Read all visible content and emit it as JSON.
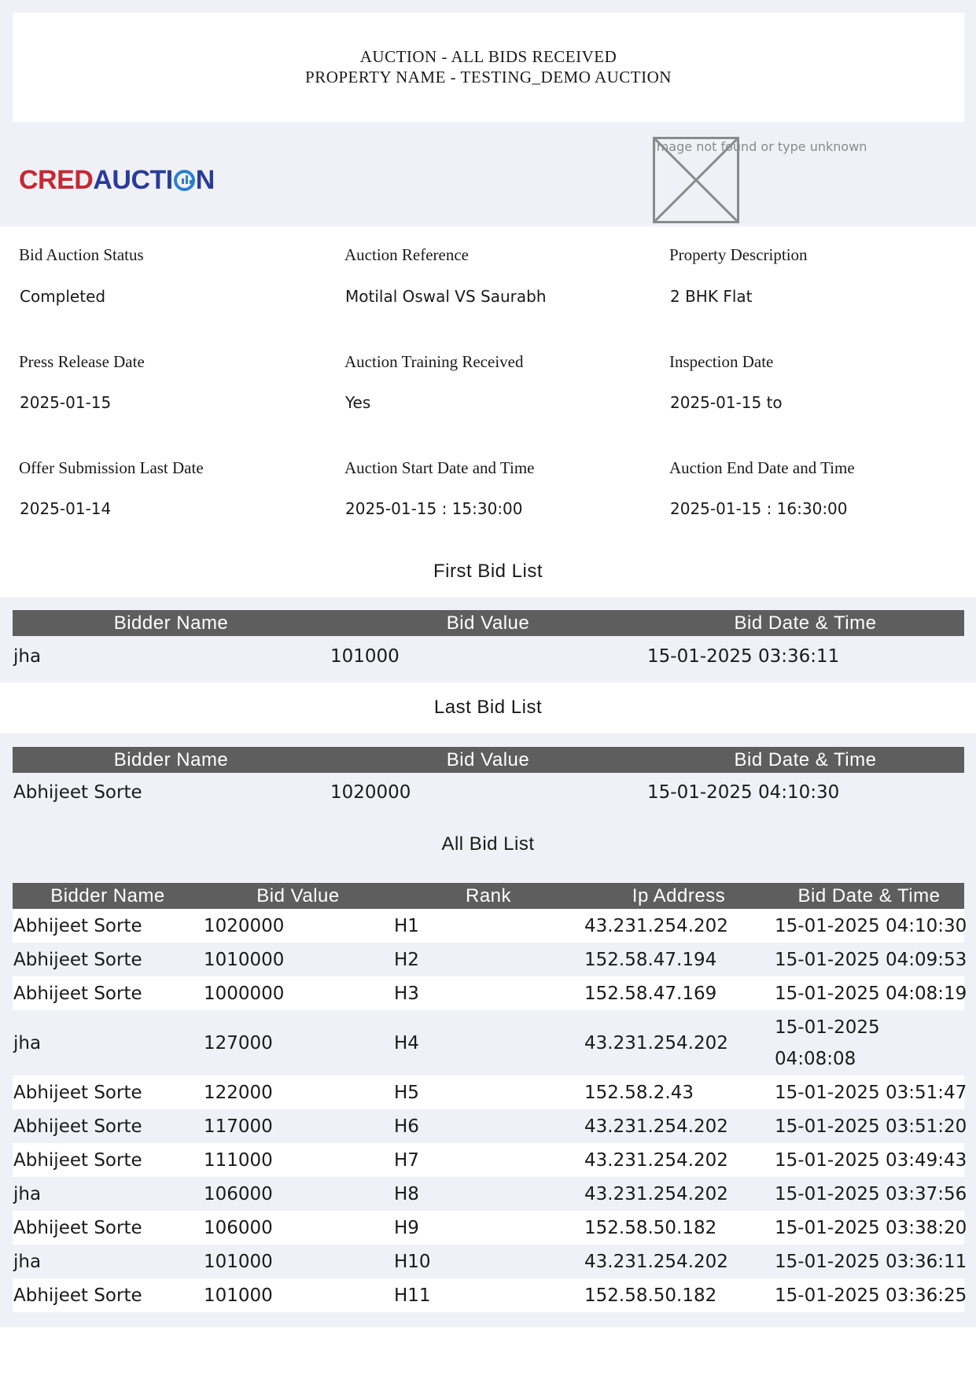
{
  "header": {
    "title_line1": "AUCTION - ALL BIDS RECEIVED",
    "title_line2": "PROPERTY NAME - TESTING_DEMO AUCTION"
  },
  "logo": {
    "part1": "CRED",
    "part2": "AUCTI",
    "part3": "N"
  },
  "broken_image_text": "Image not found or type unknown",
  "fields": [
    {
      "label": "Bid Auction Status",
      "value": "Completed"
    },
    {
      "label": "Auction Reference",
      "value": "Motilal Oswal VS Saurabh"
    },
    {
      "label": "Property Description",
      "value": "2 BHK Flat"
    },
    {
      "label": "Press Release Date",
      "value": "2025-01-15"
    },
    {
      "label": "Auction Training Received",
      "value": "Yes"
    },
    {
      "label": "Inspection Date",
      "value": "2025-01-15 to"
    },
    {
      "label": "Offer Submission Last Date",
      "value": "2025-01-14"
    },
    {
      "label": "Auction Start Date and Time",
      "value": "2025-01-15 : 15:30:00"
    },
    {
      "label": "Auction End Date and Time",
      "value": "2025-01-15 : 16:30:00"
    }
  ],
  "first_bid": {
    "title": "First Bid List",
    "headers": [
      "Bidder Name",
      "Bid Value",
      "Bid Date & Time"
    ],
    "row": [
      "jha",
      "101000",
      "15-01-2025 03:36:11"
    ]
  },
  "last_bid": {
    "title": "Last Bid List",
    "headers": [
      "Bidder Name",
      "Bid Value",
      "Bid Date & Time"
    ],
    "row": [
      "Abhijeet Sorte",
      "1020000",
      "15-01-2025 04:10:30"
    ]
  },
  "all_bids": {
    "title": "All Bid List",
    "headers": [
      "Bidder Name",
      "Bid Value",
      "Rank",
      "Ip Address",
      "Bid Date & Time"
    ],
    "rows": [
      [
        "Abhijeet Sorte",
        "1020000",
        "H1",
        "43.231.254.202",
        "15-01-2025 04:10:30"
      ],
      [
        "Abhijeet Sorte",
        "1010000",
        "H2",
        "152.58.47.194",
        "15-01-2025 04:09:53"
      ],
      [
        "Abhijeet Sorte",
        "1000000",
        "H3",
        "152.58.47.169",
        "15-01-2025 04:08:19"
      ],
      [
        "jha",
        "127000",
        "H4",
        "43.231.254.202",
        "15-01-2025 04:08:08"
      ],
      [
        "Abhijeet Sorte",
        "122000",
        "H5",
        "152.58.2.43",
        "15-01-2025 03:51:47"
      ],
      [
        "Abhijeet Sorte",
        "117000",
        "H6",
        "43.231.254.202",
        "15-01-2025 03:51:20"
      ],
      [
        "Abhijeet Sorte",
        "111000",
        "H7",
        "43.231.254.202",
        "15-01-2025 03:49:43"
      ],
      [
        "jha",
        "106000",
        "H8",
        "43.231.254.202",
        "15-01-2025 03:37:56"
      ],
      [
        "Abhijeet Sorte",
        "106000",
        "H9",
        "152.58.50.182",
        "15-01-2025 03:38:20"
      ],
      [
        "jha",
        "101000",
        "H10",
        "43.231.254.202",
        "15-01-2025 03:36:11"
      ],
      [
        "Abhijeet Sorte",
        "101000",
        "H11",
        "152.58.50.182",
        "15-01-2025 03:36:25"
      ]
    ]
  }
}
